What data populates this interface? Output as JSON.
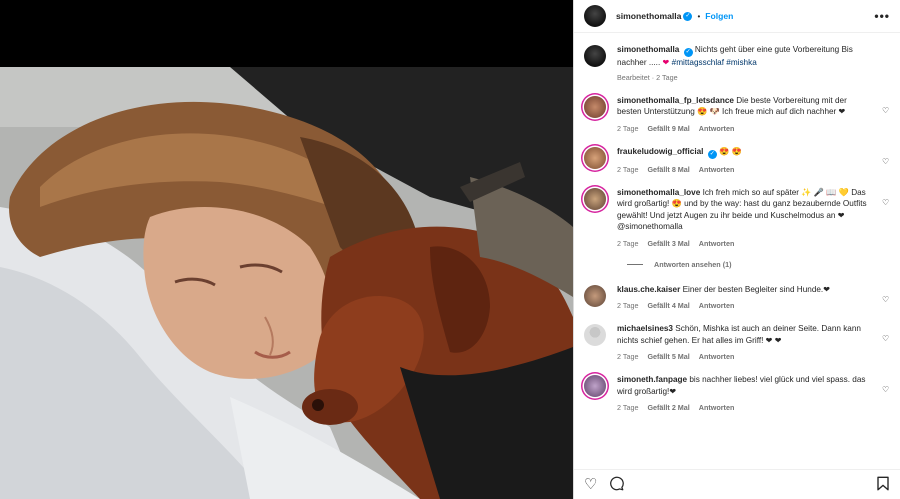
{
  "post": {
    "author": "simonethomalla",
    "follow_label": "Folgen",
    "separator": "•",
    "more_label": "•••",
    "caption_text": "Nichts geht über eine gute Vorbereitung Bis nachher ..... ❤ #mittagsschlaf #mishka",
    "caption_parts": {
      "pre": "Nichts geht über eine gute Vorbereitung Bis nachher ..... ",
      "heart": "❤",
      "tags": " #mittagsschlaf #mishka"
    },
    "edited": "Bearbeitet · 2 Tage"
  },
  "comments": [
    {
      "user": "simonethomalla_fp_letsdance",
      "text": "Die beste Vorbereitung mit der besten Unterstützung 😍 🐶 Ich freue mich auf dich nachher ❤",
      "age": "2 Tage",
      "likes": "Gefällt 9 Mal",
      "reply": "Antworten"
    },
    {
      "user": "fraukeludowig_official",
      "text": "😍 😍",
      "age": "2 Tage",
      "likes": "Gefällt 8 Mal",
      "reply": "Antworten"
    },
    {
      "user": "simonethomalla_love",
      "text": "Ich freh mich so auf später ✨ 🎤 📖 💛 Das wird großartig! 😍 und by the way: hast du ganz bezaubernde Outfits gewählt! Und jetzt Augen zu ihr beide und Kuschelmodus an ❤ @simonethomalla",
      "age": "2 Tage",
      "likes": "Gefällt 3 Mal",
      "reply": "Antworten",
      "view_replies": "Antworten ansehen (1)"
    },
    {
      "user": "klaus.che.kaiser",
      "text": "Einer der besten Begleiter sind Hunde.❤",
      "age": "2 Tage",
      "likes": "Gefällt 4 Mal",
      "reply": "Antworten"
    },
    {
      "user": "michaelsines3",
      "text": "Schön, Mishka ist auch an deiner Seite. Dann kann nichts schief gehen. Er hat alles im Griff! ❤ ❤",
      "age": "2 Tage",
      "likes": "Gefällt 5 Mal",
      "reply": "Antworten"
    },
    {
      "user": "simoneth.fanpage",
      "text": "bis nachher liebes! viel glück und viel spass. das wird großartig!❤",
      "age": "2 Tage",
      "likes": "Gefällt 2 Mal",
      "reply": "Antworten"
    }
  ],
  "footer": {
    "like_icon": "heart-outline",
    "comment_icon": "speech-bubble",
    "save_icon": "bookmark"
  },
  "colors": {
    "link": "#0095f6",
    "hashtag": "#00376b",
    "heart_emoji": "#e6006e",
    "muted": "#737373"
  }
}
